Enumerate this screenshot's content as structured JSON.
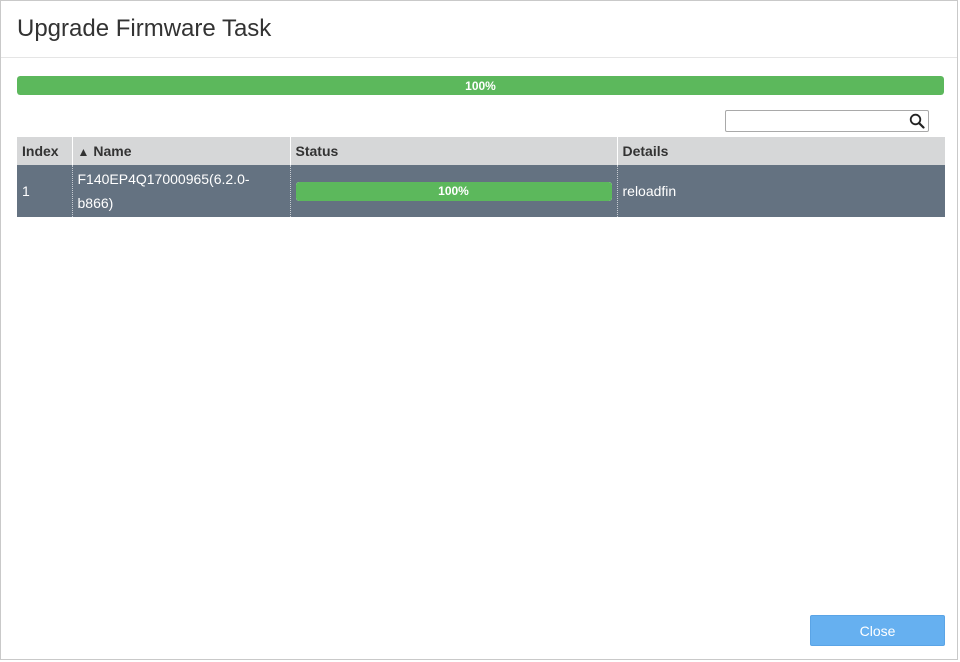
{
  "dialog": {
    "title": "Upgrade Firmware Task"
  },
  "overall_progress": {
    "value": 1.0,
    "label": "100%",
    "color": "#5cb85c"
  },
  "search": {
    "placeholder": "",
    "value": "",
    "icon": "search-icon"
  },
  "table": {
    "columns": [
      {
        "label": "Index"
      },
      {
        "label": "Name",
        "sort": "ascending",
        "sort_glyph": "▲"
      },
      {
        "label": "Status"
      },
      {
        "label": "Details"
      }
    ],
    "rows": [
      {
        "index": "1",
        "name": "F140EP4Q17000965(6.2.0-b866)",
        "status_value": 1.0,
        "status_label": "100%",
        "details": "reloadfin"
      }
    ],
    "selected_row_color": "#647281"
  },
  "footer": {
    "close_label": "Close"
  }
}
